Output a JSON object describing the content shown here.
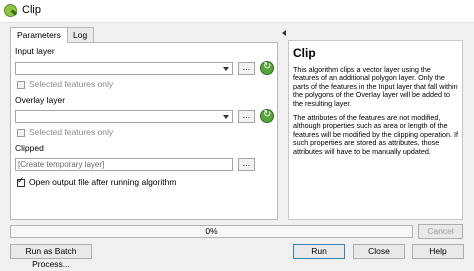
{
  "window": {
    "title": "Clip"
  },
  "tabs": [
    {
      "label": "Parameters"
    },
    {
      "label": "Log"
    }
  ],
  "params": {
    "input_layer_label": "Input layer",
    "input_selected_only": "Selected features only",
    "overlay_layer_label": "Overlay layer",
    "overlay_selected_only": "Selected features only",
    "clipped_label": "Clipped",
    "clipped_placeholder": "[Create temporary layer]",
    "open_output_label": "Open output file after running algorithm",
    "open_output_checked": true,
    "browse_label": "..."
  },
  "help": {
    "title": "Clip",
    "para1": "This algorithm clips a vector layer using the features of an additional polygon layer. Only the parts of the features in the Input layer that fall within the polygons of the Overlay layer will be added to the resulting layer.",
    "para2": "The attributes of the features are not modified, although properties such as area or length of the features will be modified by the clipping operation. If such properties are stored as attributes, those attributes will have to be manually updated."
  },
  "progress": {
    "value": 0,
    "text": "0%"
  },
  "buttons": {
    "cancel": "Cancel",
    "batch": "Run as Batch Process...",
    "run": "Run",
    "close": "Close",
    "help": "Help"
  }
}
